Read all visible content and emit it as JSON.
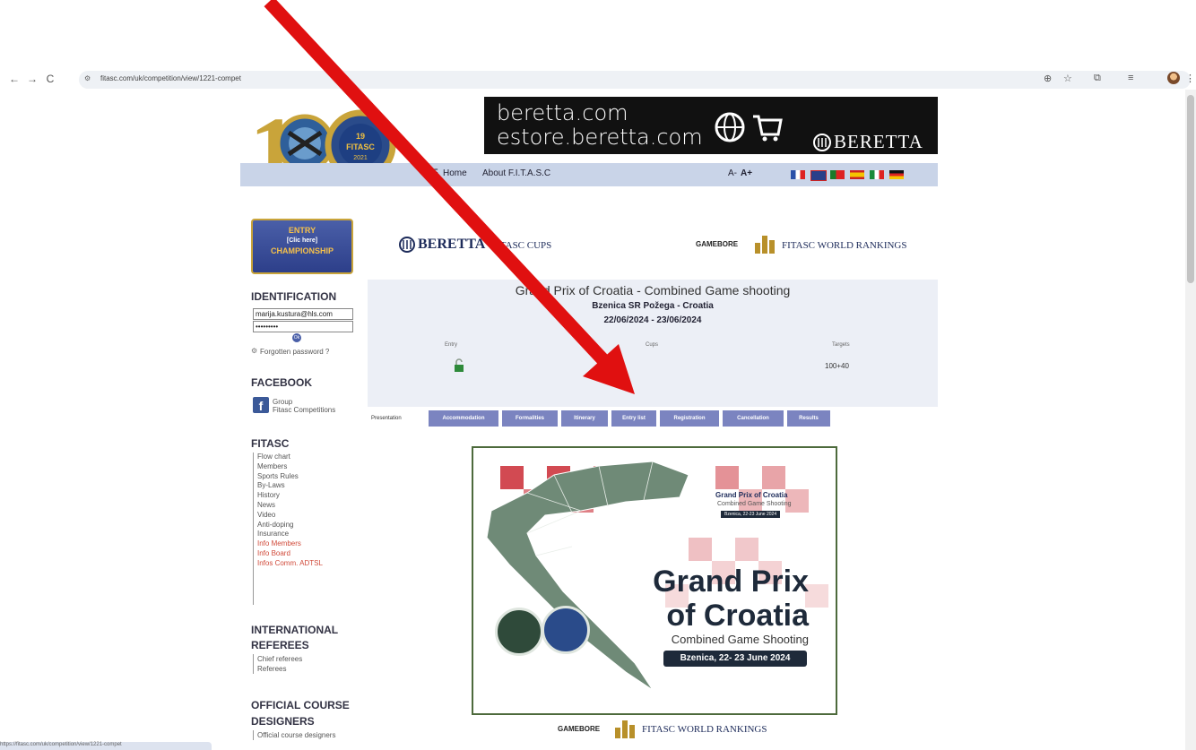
{
  "browser": {
    "url": "fitasc.com/uk/competition/view/1221-compet",
    "status_url": "https://fitasc.com/uk/competition/view/1221-compet"
  },
  "banner": {
    "line1": "beretta.com",
    "line2": "estore.beretta.com",
    "brand": "BERETTA"
  },
  "logo": {
    "line1": "19",
    "line2": "FITASC",
    "line3": "2021",
    "ring_text": "100 ANS DE SPORT · 100 YEARS OF SPORT"
  },
  "menu": {
    "home": "Home",
    "about": "About F.I.T.A.S.C",
    "font_small": "A-",
    "font_large": "A+"
  },
  "entry_button": {
    "line1": "ENTRY",
    "line2": "[Clic here]",
    "line3": "CHAMPIONSHIP"
  },
  "identification": {
    "title": "IDENTIFICATION",
    "email_value": "marija.kustura@hls.com",
    "password_value": "•••••••••",
    "ok_label": "Ok",
    "forgot": "Forgotten password ?"
  },
  "facebook": {
    "title": "FACEBOOK",
    "group_line1": "Group",
    "group_line2": "Fitasc Competitions"
  },
  "fitasc_menu": {
    "title": "FITASC",
    "items": [
      "Flow chart",
      "Members",
      "Sports Rules",
      "By-Laws",
      "History",
      "News",
      "Video",
      "Anti-doping",
      "Insurance"
    ],
    "red_items": [
      "Info Members",
      "Info Board",
      "Infos Comm. ADTSL"
    ]
  },
  "referees": {
    "title1": "INTERNATIONAL",
    "title2": "REFEREES",
    "items": [
      "Chief referees",
      "Referees"
    ]
  },
  "designers": {
    "title1": "OFFICIAL COURSE",
    "title2": "DESIGNERS",
    "items": [
      "Official course designers"
    ]
  },
  "sponsors": {
    "beretta": "BERETTA",
    "fitasc_cups": "FITASC CUPS",
    "gamebore": "GAMEBORE",
    "world_rankings": "FITASC WORLD RANKINGS"
  },
  "event": {
    "title": "Grand Prix of Croatia - Combined Game shooting",
    "location": "Bzenica SR Požega - Croatia",
    "dates": "22/06/2024 - 23/06/2024",
    "col_entry": "Entry",
    "col_cups": "Cups",
    "col_targets": "Targets",
    "targets_value": "100+40"
  },
  "tabs": {
    "presentation": "Presentation",
    "items": [
      "Accommodation",
      "Formalities",
      "Itinerary",
      "Entry list",
      "Registration",
      "Cancellation",
      "Results"
    ]
  },
  "poster": {
    "small_title": "Grand Prix of Croatia",
    "small_sub": "Combined Game Shooting",
    "small_date": "Bzenica, 22-23 June 2024",
    "title1": "Grand Prix",
    "title2": "of Croatia",
    "subtitle": "Combined Game Shooting",
    "date": "Bzenica, 22- 23 June 2024"
  },
  "colors": {
    "menubar": "#c9d4e8",
    "tab": "#7b84c0",
    "arrow": "#e01010",
    "event_box": "#eceff6"
  }
}
